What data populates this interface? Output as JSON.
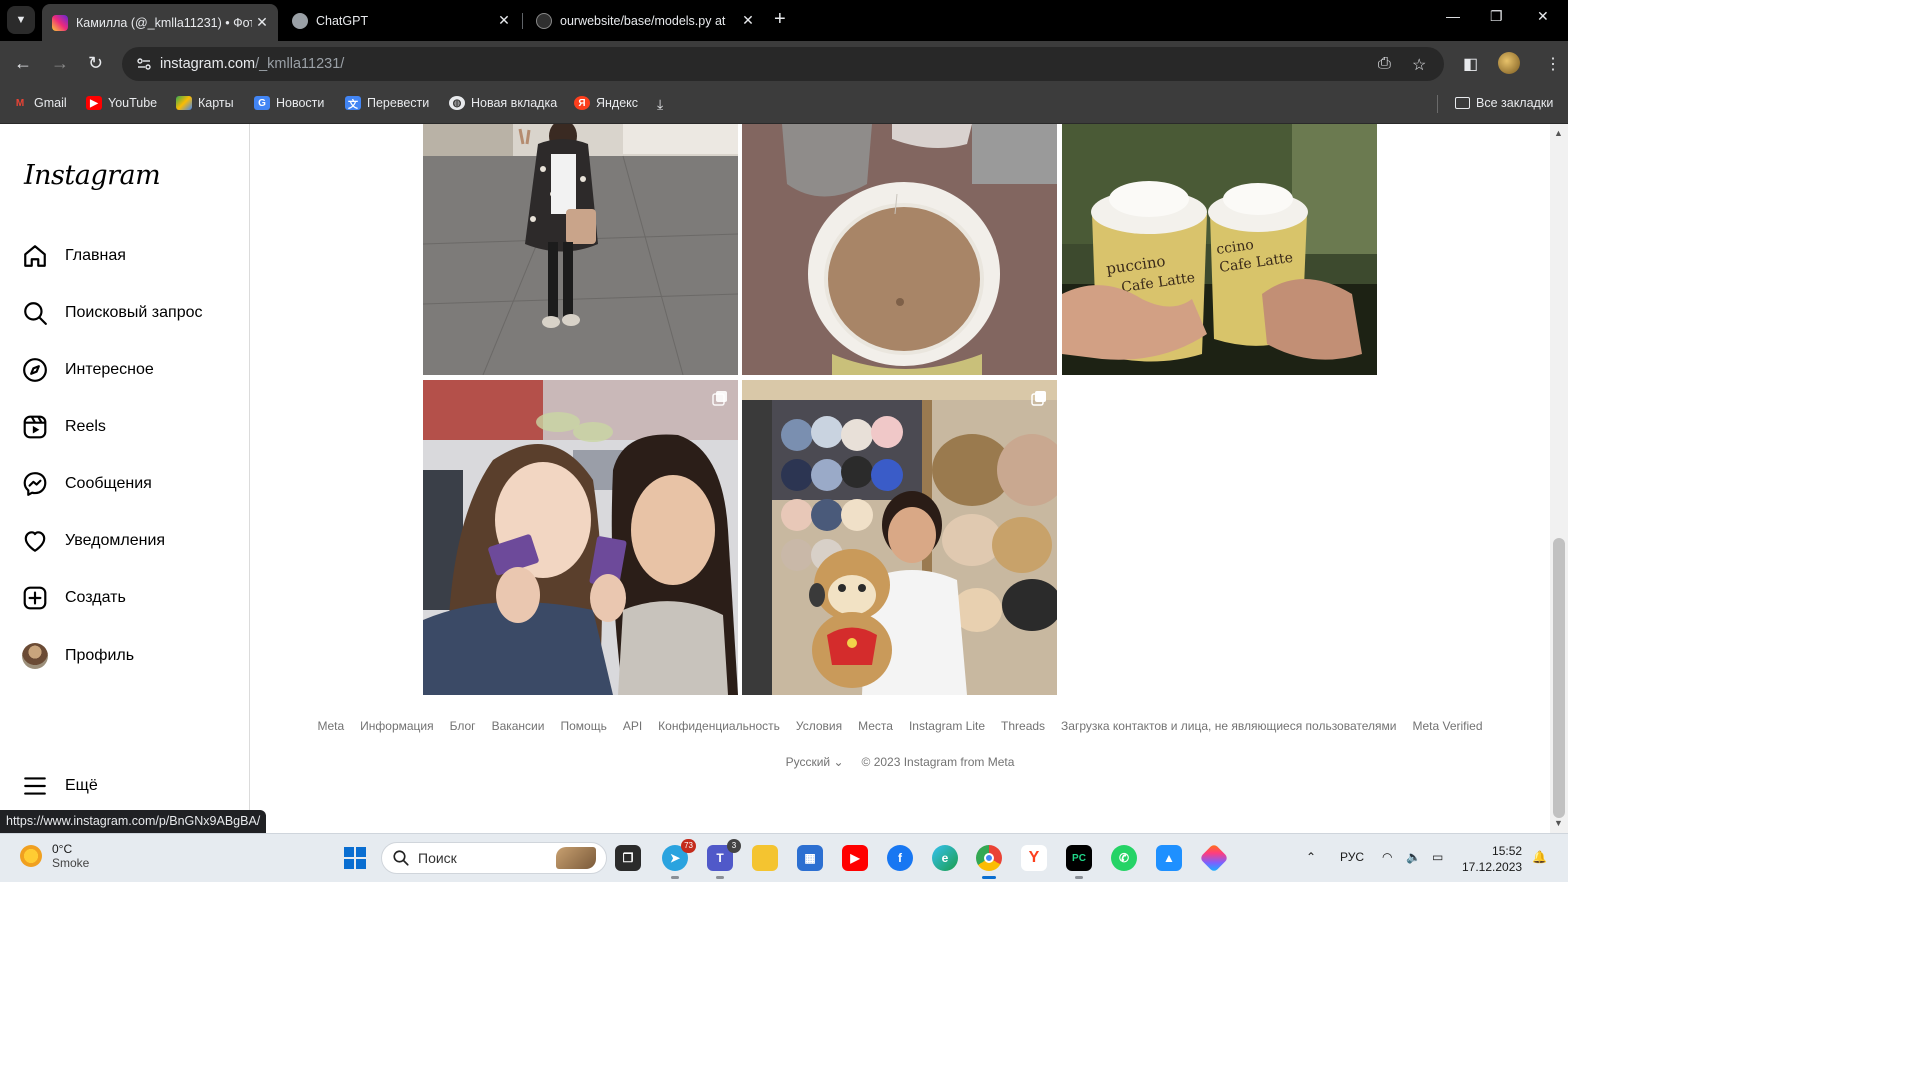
{
  "browser": {
    "tabs": [
      {
        "title": "Камилла (@_kmlla11231) • Фот",
        "active": true
      },
      {
        "title": "ChatGPT",
        "active": false
      },
      {
        "title": "ourwebsite/base/models.py at ",
        "active": false
      }
    ],
    "url_host": "instagram.com",
    "url_path": "/_kmlla11231/",
    "bookmarks": [
      "Gmail",
      "YouTube",
      "Карты",
      "Новости",
      "Перевести",
      "Новая вкладка",
      "Яндекс"
    ],
    "all_bookmarks_label": "Все закладки",
    "status_url": "https://www.instagram.com/p/BnGNx9ABgBA/"
  },
  "instagram": {
    "logo": "Instagram",
    "nav": [
      {
        "label": "Главная",
        "icon": "home-icon"
      },
      {
        "label": "Поисковый запрос",
        "icon": "search-icon"
      },
      {
        "label": "Интересное",
        "icon": "compass-icon"
      },
      {
        "label": "Reels",
        "icon": "reels-icon"
      },
      {
        "label": "Сообщения",
        "icon": "messenger-icon"
      },
      {
        "label": "Уведомления",
        "icon": "heart-icon"
      },
      {
        "label": "Создать",
        "icon": "create-icon"
      },
      {
        "label": "Профиль",
        "icon": "profile-avatar"
      }
    ],
    "more_label": "Ещё",
    "posts": [
      {
        "name": "post-girl-square",
        "multi": false
      },
      {
        "name": "post-coffee-cup",
        "multi": false
      },
      {
        "name": "post-cafe-latte",
        "multi": false
      },
      {
        "name": "post-selfie-friends",
        "multi": true
      },
      {
        "name": "post-hat-store",
        "multi": true
      }
    ],
    "footer_links": [
      "Meta",
      "Информация",
      "Блог",
      "Вакансии",
      "Помощь",
      "API",
      "Конфиденциальность",
      "Условия",
      "Места",
      "Instagram Lite",
      "Threads",
      "Загрузка контактов и лица, не являющиеся пользователями",
      "Meta Verified"
    ],
    "language": "Русский",
    "copyright": "© 2023 Instagram from Meta"
  },
  "taskbar": {
    "weather_temp": "0°C",
    "weather_desc": "Smoke",
    "search_label": "Поиск",
    "telegram_badge": "73",
    "teams_badge": "3",
    "lang": "РУС",
    "time": "15:52",
    "date": "17.12.2023"
  },
  "colors": {
    "chrome_dark": "#000000",
    "toolbar": "#3c3c3c",
    "ig_text": "#262626",
    "footer_text": "#737373",
    "taskbar": "#e6ebf0"
  }
}
